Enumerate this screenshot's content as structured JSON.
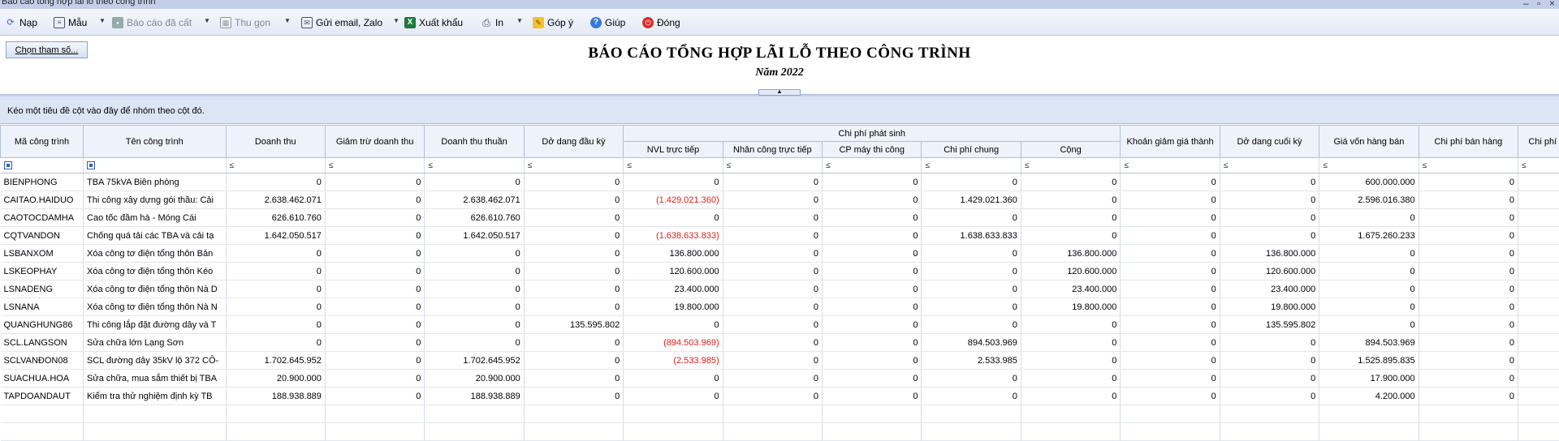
{
  "window": {
    "title": "Báo cáo tổng hợp lãi lỗ theo công trình",
    "close": "×"
  },
  "toolbar": {
    "reload": "Nạp",
    "template": "Mẫu",
    "saved": "Báo cáo đã cất",
    "collapse": "Thu gọn",
    "email": "Gửi email, Zalo",
    "export": "Xuất khẩu",
    "print": "In",
    "feedback": "Góp ý",
    "help": "Giúp",
    "close": "Đóng"
  },
  "params_button": "Chọn tham số...",
  "report": {
    "title": "BÁO CÁO TỔNG HỢP LÃI LỖ THEO CÔNG TRÌNH",
    "subtitle": "Năm 2022"
  },
  "group_hint": "Kéo một tiêu đề cột vào đây để nhóm theo cột đó.",
  "columns": {
    "code": "Mã công trình",
    "name": "Tên công trình",
    "revenue": "Doanh thu",
    "deduction": "Giảm trừ doanh thu",
    "net_revenue": "Doanh thu thuần",
    "opening_wip": "Dở dang đầu kỳ",
    "costs_group": "Chi phí phát sinh",
    "materials": "NVL trực tiếp",
    "labor": "Nhân công trực tiếp",
    "machine": "CP máy thi công",
    "overhead": "Chi phí chung",
    "total": "Cộng",
    "cost_reduction": "Khoản giảm giá thành",
    "closing_wip": "Dở dang cuối kỳ",
    "cogs": "Giá vốn hàng bán",
    "selling": "Chi phí bán hàng",
    "admin": "Chi phí quản"
  },
  "filter_symbol": "≤",
  "rows": [
    [
      "BIENPHONG",
      "TBA 75kVA Biên phòng",
      "0",
      "0",
      "0",
      "0",
      "0",
      "0",
      "0",
      "0",
      "0",
      "0",
      "0",
      "600.000.000",
      "0"
    ],
    [
      "CAITAO.HAIDUO",
      "Thi công xây dựng gói thầu: Cải",
      "2.638.462.071",
      "0",
      "2.638.462.071",
      "0",
      "(1.429.021.360)",
      "0",
      "0",
      "1.429.021.360",
      "0",
      "0",
      "0",
      "2.596.016.380",
      "0"
    ],
    [
      "CAOTOCDAMHA",
      " Cao tốc đầm hà - Móng Cái",
      "626.610.760",
      "0",
      "626.610.760",
      "0",
      "0",
      "0",
      "0",
      "0",
      "0",
      "0",
      "0",
      "0",
      "0"
    ],
    [
      "CQTVANDON",
      "Chống quá tải các TBA và cải tạ",
      "1.642.050.517",
      "0",
      "1.642.050.517",
      "0",
      "(1.638.633.833)",
      "0",
      "0",
      "1.638.633.833",
      "0",
      "0",
      "0",
      "1.675.260.233",
      "0"
    ],
    [
      "LSBANXOM",
      "Xóa công tơ điện tổng thôn Bản",
      "0",
      "0",
      "0",
      "0",
      "136.800.000",
      "0",
      "0",
      "0",
      "136.800.000",
      "0",
      "136.800.000",
      "0",
      "0"
    ],
    [
      "LSKEOPHAY",
      "Xóa công tơ điện tổng thôn Kéo",
      "0",
      "0",
      "0",
      "0",
      "120.600.000",
      "0",
      "0",
      "0",
      "120.600.000",
      "0",
      "120.600.000",
      "0",
      "0"
    ],
    [
      "LSNADENG",
      "Xóa công tơ điện tổng thôn Nà D",
      "0",
      "0",
      "0",
      "0",
      "23.400.000",
      "0",
      "0",
      "0",
      "23.400.000",
      "0",
      "23.400.000",
      "0",
      "0"
    ],
    [
      "LSNANA",
      "Xóa công tơ điện tổng thôn Nà N",
      "0",
      "0",
      "0",
      "0",
      "19.800.000",
      "0",
      "0",
      "0",
      "19.800.000",
      "0",
      "19.800.000",
      "0",
      "0"
    ],
    [
      "QUANGHUNG86",
      "Thi công lắp đặt đường dây và T",
      "0",
      "0",
      "0",
      "135.595.802",
      "0",
      "0",
      "0",
      "0",
      "0",
      "0",
      "135.595.802",
      "0",
      "0"
    ],
    [
      "SCL.LANGSON",
      "Sửa chữa lớn Lạng Sơn",
      "0",
      "0",
      "0",
      "0",
      "(894.503.969)",
      "0",
      "0",
      "894.503.969",
      "0",
      "0",
      "0",
      "894.503.969",
      "0"
    ],
    [
      "SCLVANĐON08",
      "SCL đường dây 35kV lộ 372 CÔ-",
      "1.702.645.952",
      "0",
      "1.702.645.952",
      "0",
      "(2.533.985)",
      "0",
      "0",
      "2.533.985",
      "0",
      "0",
      "0",
      "1.525.895.835",
      "0"
    ],
    [
      "SUACHUA.HOA",
      "Sửa chữa, mua sắm thiết bị TBA",
      "20.900.000",
      "0",
      "20.900.000",
      "0",
      "0",
      "0",
      "0",
      "0",
      "0",
      "0",
      "0",
      "17.900.000",
      "0"
    ],
    [
      "TAPDOANDAUT",
      "Kiểm tra thử nghiệm định kỳ TB",
      "188.938.889",
      "0",
      "188.938.889",
      "0",
      "0",
      "0",
      "0",
      "0",
      "0",
      "0",
      "0",
      "4.200.000",
      "0"
    ]
  ]
}
